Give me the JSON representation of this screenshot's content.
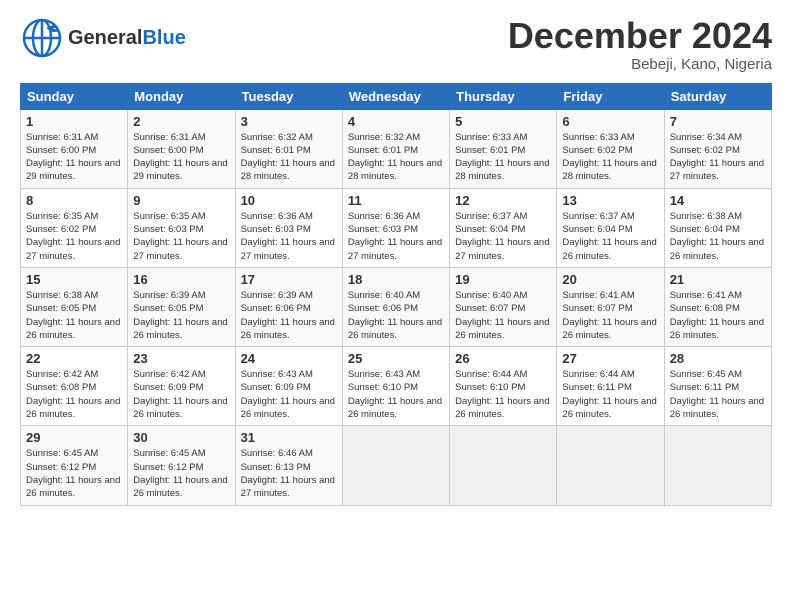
{
  "header": {
    "logo_general": "General",
    "logo_blue": "Blue",
    "month_title": "December 2024",
    "location": "Bebeji, Kano, Nigeria"
  },
  "weekdays": [
    "Sunday",
    "Monday",
    "Tuesday",
    "Wednesday",
    "Thursday",
    "Friday",
    "Saturday"
  ],
  "weeks": [
    [
      {
        "day": "1",
        "rise": "6:31 AM",
        "set": "6:00 PM",
        "daylight": "11 hours and 29 minutes."
      },
      {
        "day": "2",
        "rise": "6:31 AM",
        "set": "6:00 PM",
        "daylight": "11 hours and 29 minutes."
      },
      {
        "day": "3",
        "rise": "6:32 AM",
        "set": "6:01 PM",
        "daylight": "11 hours and 28 minutes."
      },
      {
        "day": "4",
        "rise": "6:32 AM",
        "set": "6:01 PM",
        "daylight": "11 hours and 28 minutes."
      },
      {
        "day": "5",
        "rise": "6:33 AM",
        "set": "6:01 PM",
        "daylight": "11 hours and 28 minutes."
      },
      {
        "day": "6",
        "rise": "6:33 AM",
        "set": "6:02 PM",
        "daylight": "11 hours and 28 minutes."
      },
      {
        "day": "7",
        "rise": "6:34 AM",
        "set": "6:02 PM",
        "daylight": "11 hours and 27 minutes."
      }
    ],
    [
      {
        "day": "8",
        "rise": "6:35 AM",
        "set": "6:02 PM",
        "daylight": "11 hours and 27 minutes."
      },
      {
        "day": "9",
        "rise": "6:35 AM",
        "set": "6:03 PM",
        "daylight": "11 hours and 27 minutes."
      },
      {
        "day": "10",
        "rise": "6:36 AM",
        "set": "6:03 PM",
        "daylight": "11 hours and 27 minutes."
      },
      {
        "day": "11",
        "rise": "6:36 AM",
        "set": "6:03 PM",
        "daylight": "11 hours and 27 minutes."
      },
      {
        "day": "12",
        "rise": "6:37 AM",
        "set": "6:04 PM",
        "daylight": "11 hours and 27 minutes."
      },
      {
        "day": "13",
        "rise": "6:37 AM",
        "set": "6:04 PM",
        "daylight": "11 hours and 26 minutes."
      },
      {
        "day": "14",
        "rise": "6:38 AM",
        "set": "6:04 PM",
        "daylight": "11 hours and 26 minutes."
      }
    ],
    [
      {
        "day": "15",
        "rise": "6:38 AM",
        "set": "6:05 PM",
        "daylight": "11 hours and 26 minutes."
      },
      {
        "day": "16",
        "rise": "6:39 AM",
        "set": "6:05 PM",
        "daylight": "11 hours and 26 minutes."
      },
      {
        "day": "17",
        "rise": "6:39 AM",
        "set": "6:06 PM",
        "daylight": "11 hours and 26 minutes."
      },
      {
        "day": "18",
        "rise": "6:40 AM",
        "set": "6:06 PM",
        "daylight": "11 hours and 26 minutes."
      },
      {
        "day": "19",
        "rise": "6:40 AM",
        "set": "6:07 PM",
        "daylight": "11 hours and 26 minutes."
      },
      {
        "day": "20",
        "rise": "6:41 AM",
        "set": "6:07 PM",
        "daylight": "11 hours and 26 minutes."
      },
      {
        "day": "21",
        "rise": "6:41 AM",
        "set": "6:08 PM",
        "daylight": "11 hours and 26 minutes."
      }
    ],
    [
      {
        "day": "22",
        "rise": "6:42 AM",
        "set": "6:08 PM",
        "daylight": "11 hours and 26 minutes."
      },
      {
        "day": "23",
        "rise": "6:42 AM",
        "set": "6:09 PM",
        "daylight": "11 hours and 26 minutes."
      },
      {
        "day": "24",
        "rise": "6:43 AM",
        "set": "6:09 PM",
        "daylight": "11 hours and 26 minutes."
      },
      {
        "day": "25",
        "rise": "6:43 AM",
        "set": "6:10 PM",
        "daylight": "11 hours and 26 minutes."
      },
      {
        "day": "26",
        "rise": "6:44 AM",
        "set": "6:10 PM",
        "daylight": "11 hours and 26 minutes."
      },
      {
        "day": "27",
        "rise": "6:44 AM",
        "set": "6:11 PM",
        "daylight": "11 hours and 26 minutes."
      },
      {
        "day": "28",
        "rise": "6:45 AM",
        "set": "6:11 PM",
        "daylight": "11 hours and 26 minutes."
      }
    ],
    [
      {
        "day": "29",
        "rise": "6:45 AM",
        "set": "6:12 PM",
        "daylight": "11 hours and 26 minutes."
      },
      {
        "day": "30",
        "rise": "6:45 AM",
        "set": "6:12 PM",
        "daylight": "11 hours and 26 minutes."
      },
      {
        "day": "31",
        "rise": "6:46 AM",
        "set": "6:13 PM",
        "daylight": "11 hours and 27 minutes."
      },
      null,
      null,
      null,
      null
    ]
  ]
}
